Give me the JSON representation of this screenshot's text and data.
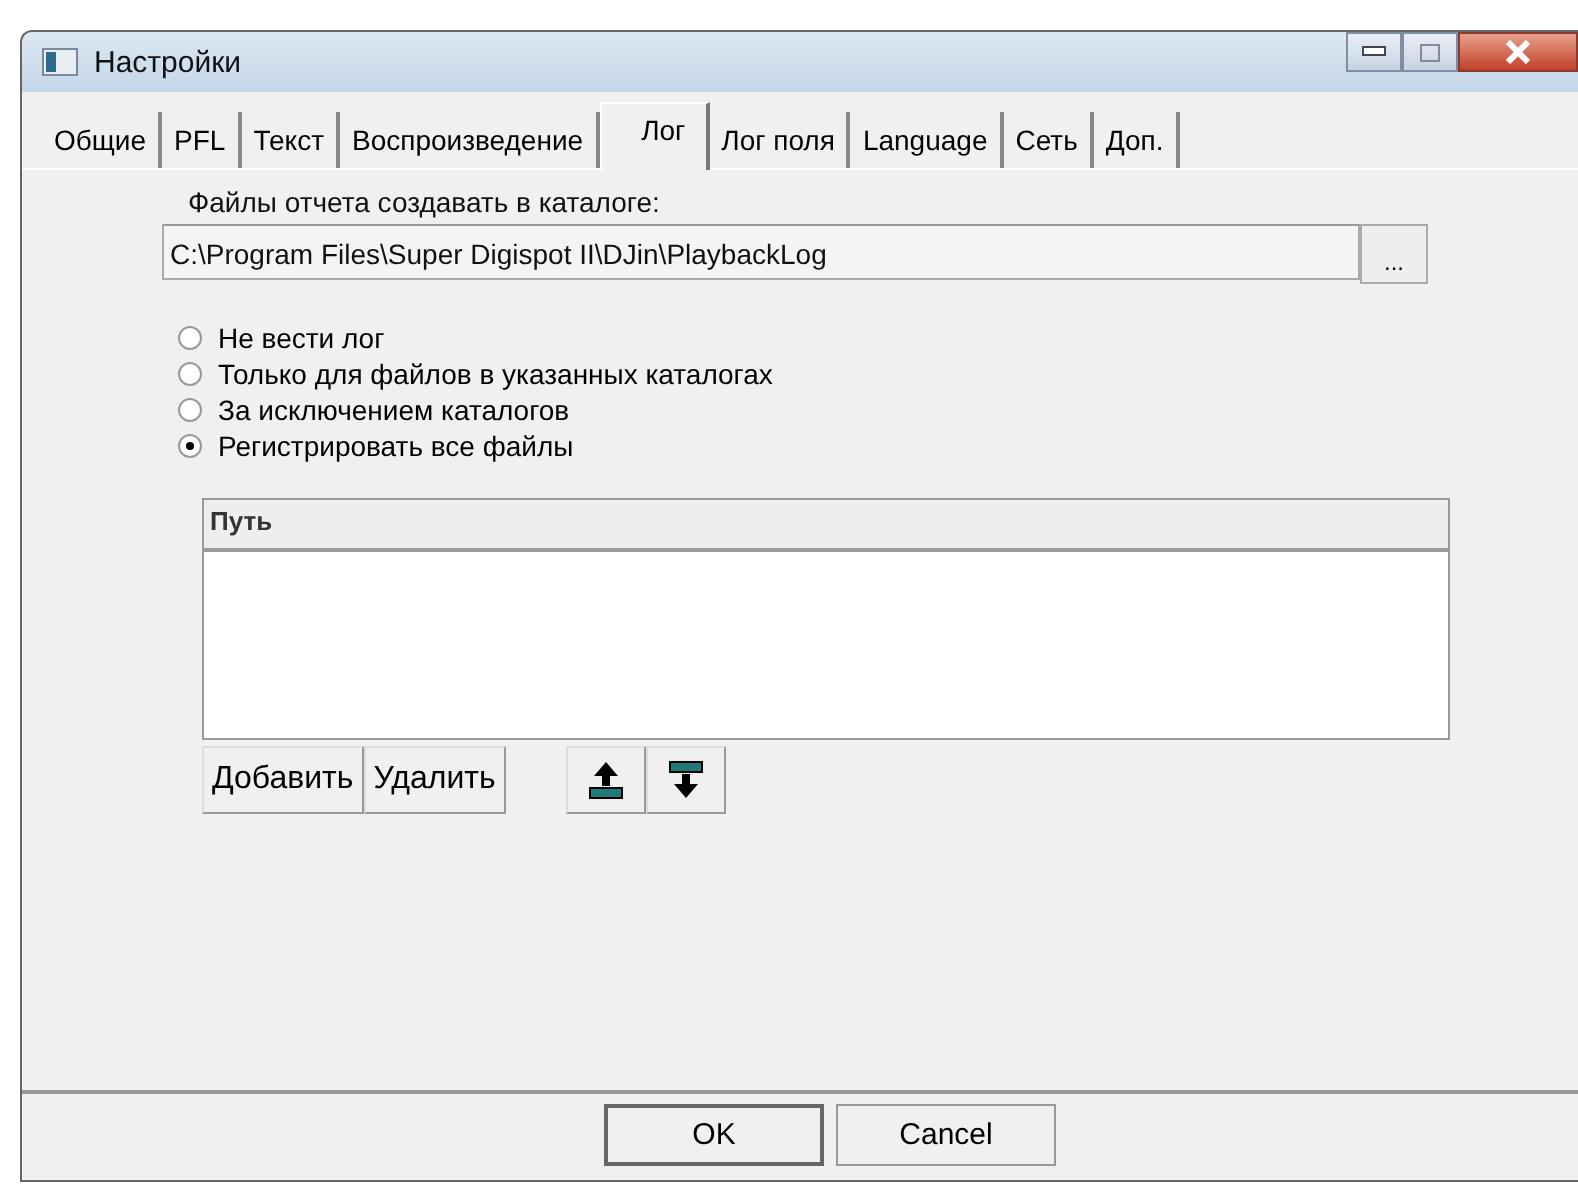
{
  "window": {
    "title": "Настройки"
  },
  "tabs": [
    {
      "label": "Общие",
      "selected": false
    },
    {
      "label": "PFL",
      "selected": false
    },
    {
      "label": "Текст",
      "selected": false
    },
    {
      "label": "Воспроизведение",
      "selected": false
    },
    {
      "label": "Лог",
      "selected": true
    },
    {
      "label": "Лог поля",
      "selected": false
    },
    {
      "label": "Language",
      "selected": false
    },
    {
      "label": "Сеть",
      "selected": false
    },
    {
      "label": "Доп.",
      "selected": false
    }
  ],
  "folder": {
    "label": "Файлы отчета создавать в каталоге:",
    "value": "C:\\Program Files\\Super Digispot II\\DJin\\PlaybackLog",
    "browse": "..."
  },
  "options": [
    {
      "label": "Не вести лог",
      "selected": false
    },
    {
      "label": "Только для файлов в указанных каталогах",
      "selected": false
    },
    {
      "label": "За исключением каталогов",
      "selected": false
    },
    {
      "label": "Регистрировать все файлы",
      "selected": true
    }
  ],
  "list": {
    "columns": [
      "Путь"
    ]
  },
  "list_buttons": [
    "Добавить",
    "Удалить"
  ],
  "buttons": [
    "OK",
    "Cancel"
  ]
}
